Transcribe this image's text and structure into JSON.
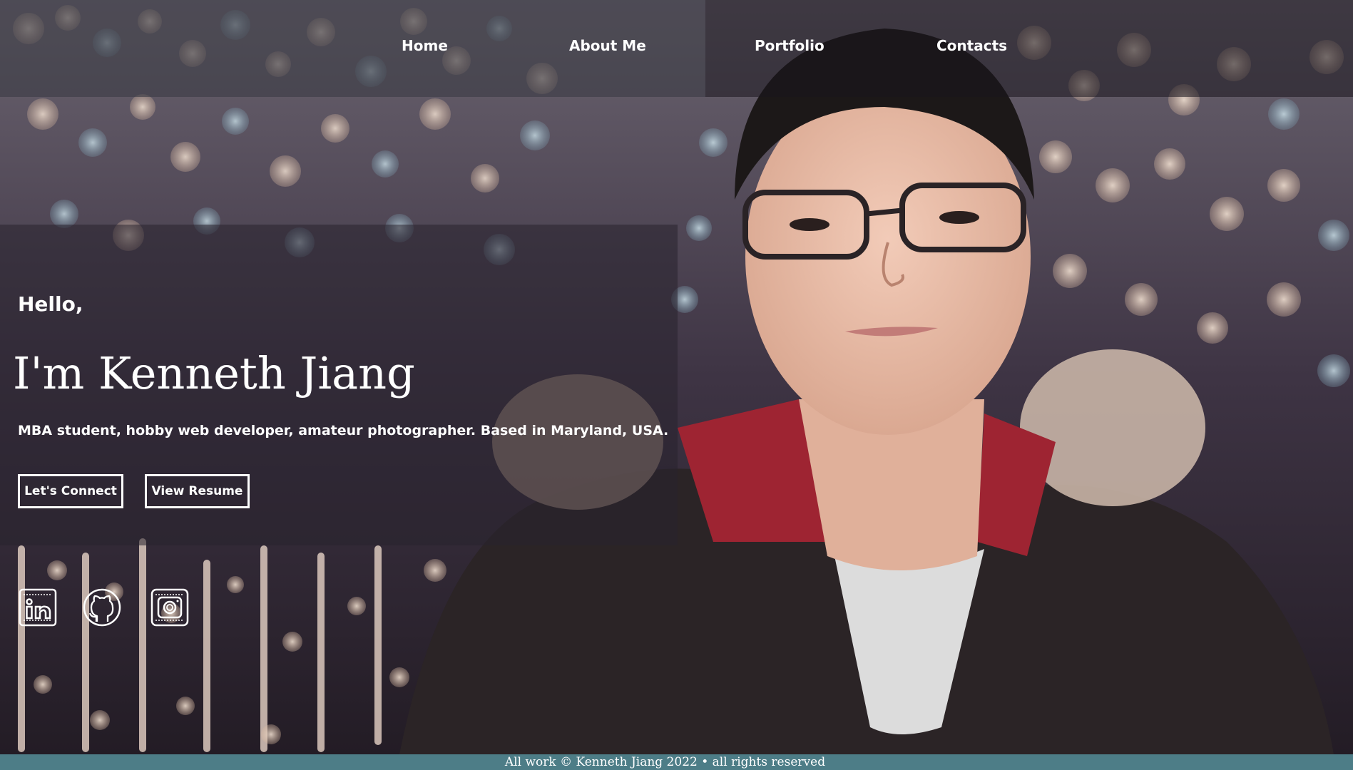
{
  "nav": {
    "items": [
      {
        "label": "Home"
      },
      {
        "label": "About Me"
      },
      {
        "label": "Portfolio"
      },
      {
        "label": "Contacts"
      }
    ]
  },
  "hero": {
    "greeting": "Hello,",
    "name": "I'm Kenneth Jiang",
    "tagline": "MBA student, hobby web developer, amateur photographer. Based in Maryland, USA.",
    "buttons": {
      "connect": "Let's Connect",
      "resume": "View Resume"
    }
  },
  "socials": [
    {
      "icon": "linkedin-icon"
    },
    {
      "icon": "github-icon"
    },
    {
      "icon": "instagram-icon"
    }
  ],
  "footer": {
    "text": "All work © Kenneth Jiang 2022 • all rights reserved"
  },
  "colors": {
    "footer_bg": "#4d7d87",
    "text": "#ffffff"
  }
}
